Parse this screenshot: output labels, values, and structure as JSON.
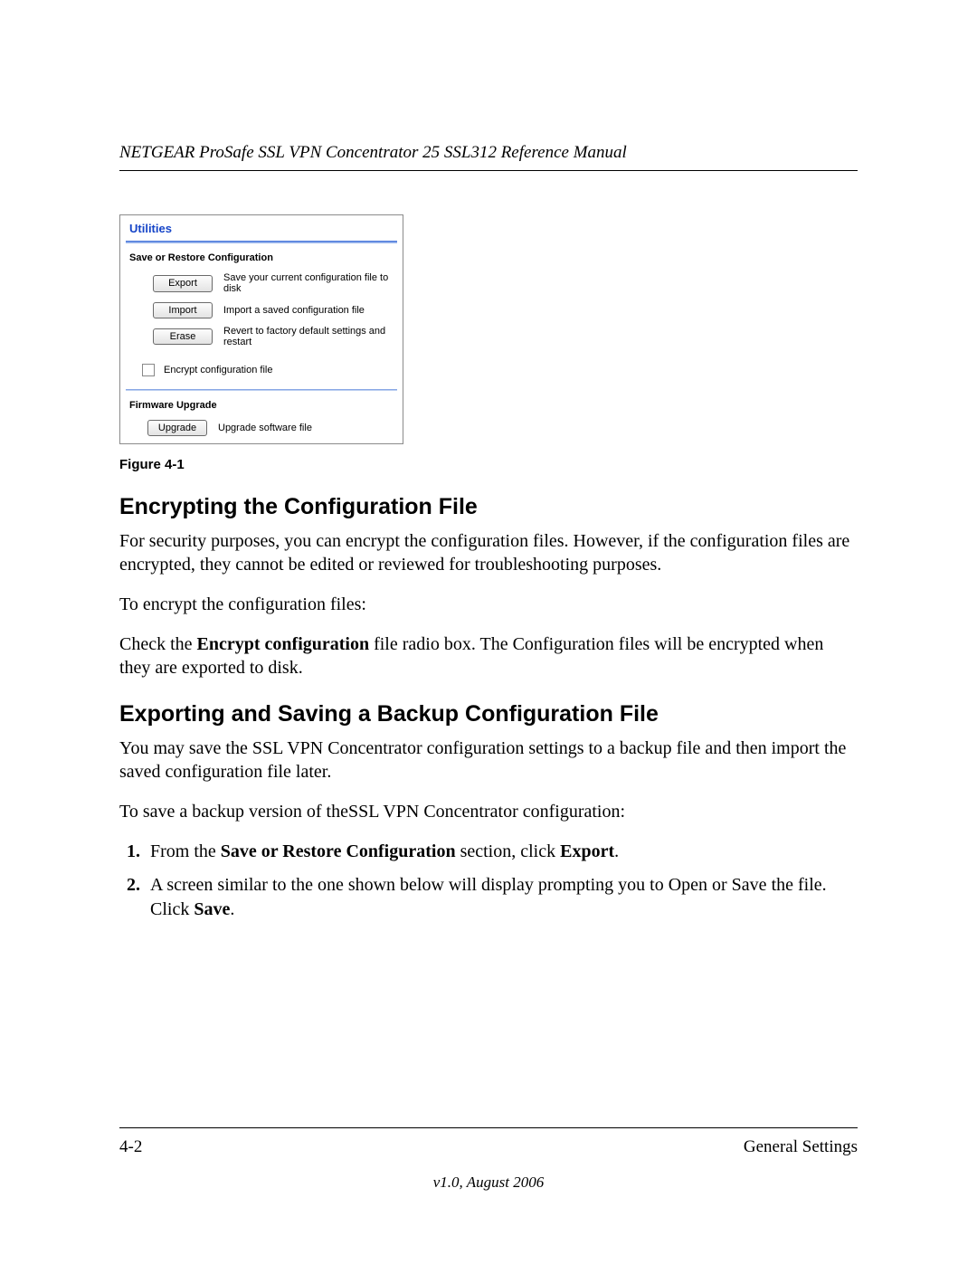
{
  "header": {
    "running": "NETGEAR ProSafe SSL VPN Concentrator 25 SSL312 Reference Manual"
  },
  "panel": {
    "title": "Utilities",
    "section1": "Save or Restore Configuration",
    "rows": [
      {
        "btn": "Export",
        "desc": "Save your current configuration file to disk"
      },
      {
        "btn": "Import",
        "desc": "Import a saved configuration file"
      },
      {
        "btn": "Erase",
        "desc": "Revert to factory default settings and restart"
      }
    ],
    "encrypt_label": "Encrypt configuration file",
    "section2": "Firmware Upgrade",
    "upgrade_btn": "Upgrade",
    "upgrade_desc": "Upgrade software file"
  },
  "fig_caption": "Figure 4-1",
  "h1": "Encrypting the Configuration File",
  "p1": "For security purposes, you can encrypt the configuration files. However, if the configuration files are encrypted, they cannot be edited or reviewed for troubleshooting purposes.",
  "p2": "To encrypt the configuration files:",
  "p3_a": "Check the ",
  "p3_b": "Encrypt configuration",
  "p3_c": " file radio box. The Configuration files will be encrypted when they are exported to disk.",
  "h2": "Exporting and Saving a Backup Configuration File",
  "p4": "You may save the SSL VPN Concentrator configuration settings to a backup file and then import the saved configuration file later.",
  "p5": "To save a backup version of theSSL VPN Concentrator configuration:",
  "step1_a": "From the ",
  "step1_b": "Save or Restore Configuration",
  "step1_c": " section, click ",
  "step1_d": "Export",
  "step1_e": ".",
  "step2_a": "A screen similar to the one shown below will display prompting you to Open or Save the file. Click ",
  "step2_b": "Save",
  "step2_c": ".",
  "footer": {
    "left": "4-2",
    "right": "General Settings",
    "version": "v1.0, August 2006"
  }
}
